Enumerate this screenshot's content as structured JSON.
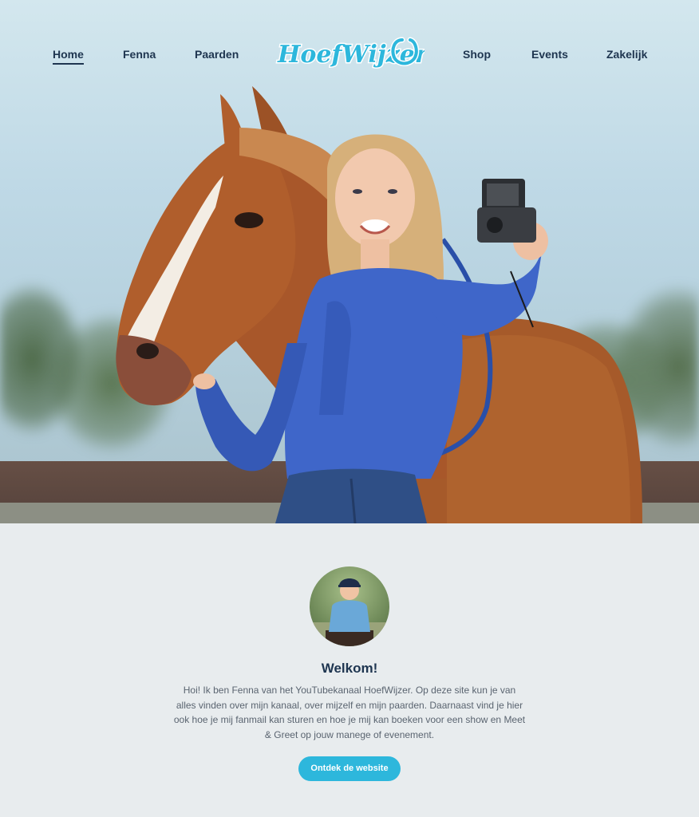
{
  "nav": {
    "home": "Home",
    "fenna": "Fenna",
    "paarden": "Paarden",
    "shop": "Shop",
    "events": "Events",
    "zakelijk": "Zakelijk"
  },
  "logo": {
    "text": "HoefWijzer",
    "icon": "horseshoe-icon"
  },
  "welcome": {
    "title": "Welkom!",
    "body": "Hoi! Ik ben Fenna van het YouTubekanaal HoefWijzer. Op deze site kun je van alles vinden over mijn kanaal, over mijzelf en mijn paarden. Daarnaast vind je hier ook hoe je mij fanmail kan sturen en hoe je mij kan boeken voor een show en Meet & Greet op jouw manege of evenement.",
    "button": "Ontdek de website"
  },
  "colors": {
    "accent": "#2db7dc",
    "navy": "#1e3550",
    "page_bg": "#e8ecee"
  }
}
